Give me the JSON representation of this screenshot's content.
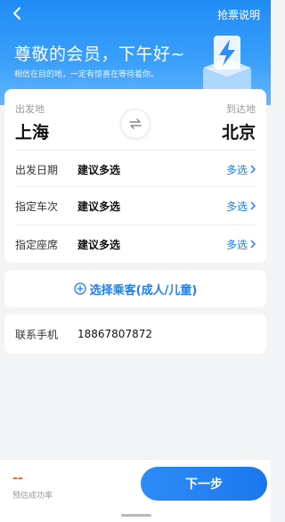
{
  "header": {
    "help_link": "抢票说明",
    "greeting": "尊敬的会员，下午好~",
    "subtitle": "相信在目的地，一定有惊喜在等待着你。",
    "back_icon": "chevron-left-icon",
    "colors": {
      "gradient_top": "#1f8cf5",
      "gradient_bottom": "#64b7fd"
    }
  },
  "route": {
    "from_label": "出发地",
    "from_city": "上海",
    "to_label": "到达地",
    "to_city": "北京",
    "swap_icon": "swap-icon"
  },
  "rows": [
    {
      "key": "出发日期",
      "value": "建议多选",
      "more": "多选"
    },
    {
      "key": "指定车次",
      "value": "建议多选",
      "more": "多选"
    },
    {
      "key": "指定座席",
      "value": "建议多选",
      "more": "多选"
    }
  ],
  "passenger": {
    "label": "选择乘客(成人/儿童)"
  },
  "contact": {
    "key": "联系手机",
    "phone": "18867807872"
  },
  "footer": {
    "rate_value": "--",
    "rate_label": "预估成功率",
    "next_label": "下一步",
    "accent": "#1e7ef0"
  }
}
